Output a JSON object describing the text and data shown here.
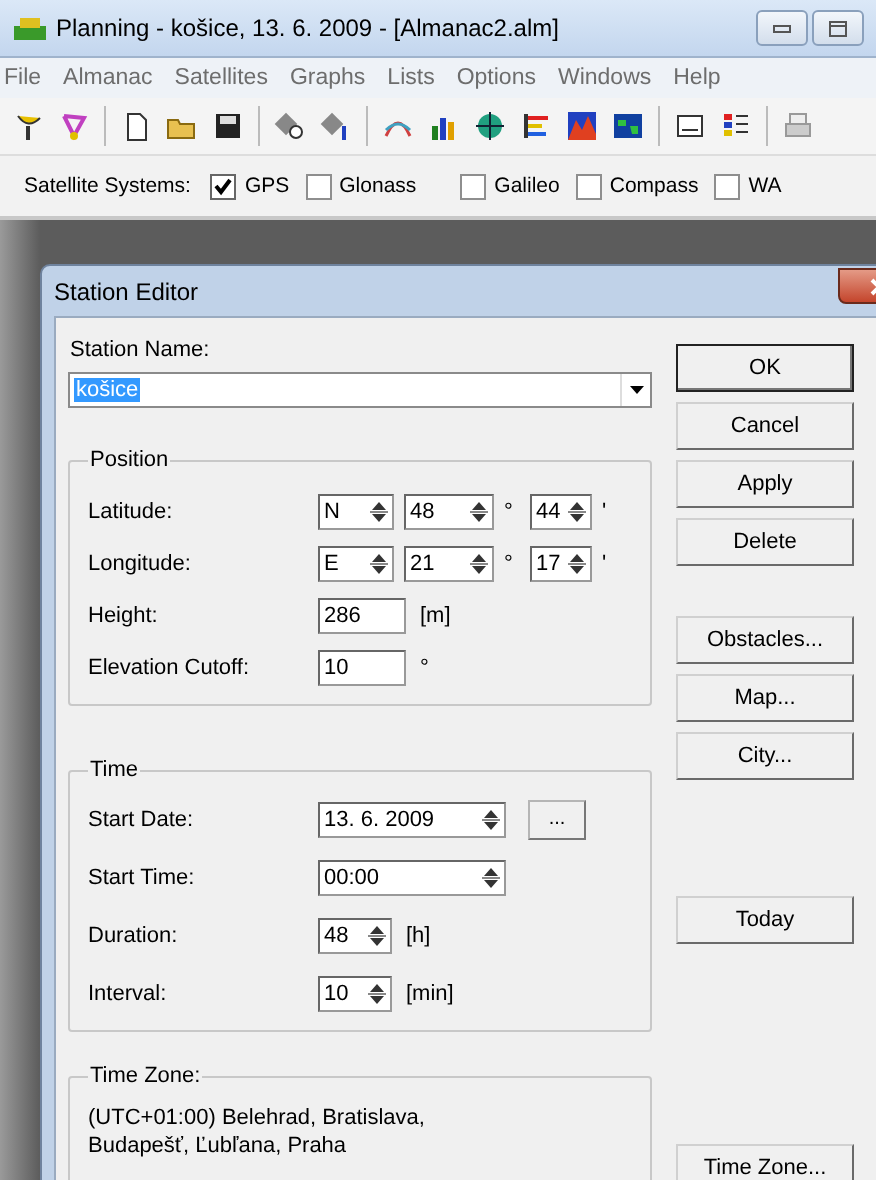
{
  "app": {
    "title": "Planning - košice, 13. 6. 2009 - [Almanac2.alm]"
  },
  "menu": [
    "File",
    "Almanac",
    "Satellites",
    "Graphs",
    "Lists",
    "Options",
    "Windows",
    "Help"
  ],
  "satellite_systems": {
    "label": "Satellite Systems:",
    "options": [
      {
        "label": "GPS",
        "checked": true
      },
      {
        "label": "Glonass",
        "checked": false
      },
      {
        "label": "Galileo",
        "checked": false
      },
      {
        "label": "Compass",
        "checked": false
      },
      {
        "label": "WA",
        "checked": false
      }
    ]
  },
  "dialog": {
    "title": "Station Editor",
    "station_name": {
      "label": "Station Name:",
      "value": "košice"
    },
    "position": {
      "title": "Position",
      "rows": [
        {
          "kind": "coord",
          "label": "Latitude:",
          "hemisphere": "N",
          "degrees": "48",
          "degree_mark": "°",
          "minutes": "44",
          "minute_mark": "'"
        },
        {
          "kind": "coord",
          "label": "Longitude:",
          "hemisphere": "E",
          "degrees": "21",
          "degree_mark": "°",
          "minutes": "17",
          "minute_mark": "'"
        },
        {
          "kind": "value",
          "label": "Height:",
          "value": "286",
          "unit": "[m]"
        },
        {
          "kind": "value",
          "label": "Elevation Cutoff:",
          "value": "10",
          "unit": "°"
        }
      ]
    },
    "time": {
      "title": "Time",
      "rows": [
        {
          "kind": "date",
          "label": "Start Date:",
          "value": "13. 6. 2009",
          "picker": "..."
        },
        {
          "kind": "time",
          "label": "Start Time:",
          "value": "00:00"
        },
        {
          "kind": "number",
          "label": "Duration:",
          "value": "48",
          "unit": "[h]"
        },
        {
          "kind": "number",
          "label": "Interval:",
          "value": "10",
          "unit": "[min]"
        }
      ]
    },
    "time_zone": {
      "title": "Time Zone:",
      "text": "(UTC+01:00) Belehrad, Bratislava, Budapešť, Ľubľana, Praha"
    },
    "button_groups": [
      [
        {
          "label": "OK",
          "default": true
        },
        {
          "label": "Cancel",
          "default": false
        },
        {
          "label": "Apply",
          "default": false
        },
        {
          "label": "Delete",
          "default": false
        }
      ],
      [
        {
          "label": "Obstacles...",
          "default": false
        },
        {
          "label": "Map...",
          "default": false
        },
        {
          "label": "City...",
          "default": false
        }
      ],
      [
        {
          "label": "Today",
          "default": false
        }
      ],
      [
        {
          "label": "Time Zone...",
          "default": false
        }
      ]
    ]
  }
}
